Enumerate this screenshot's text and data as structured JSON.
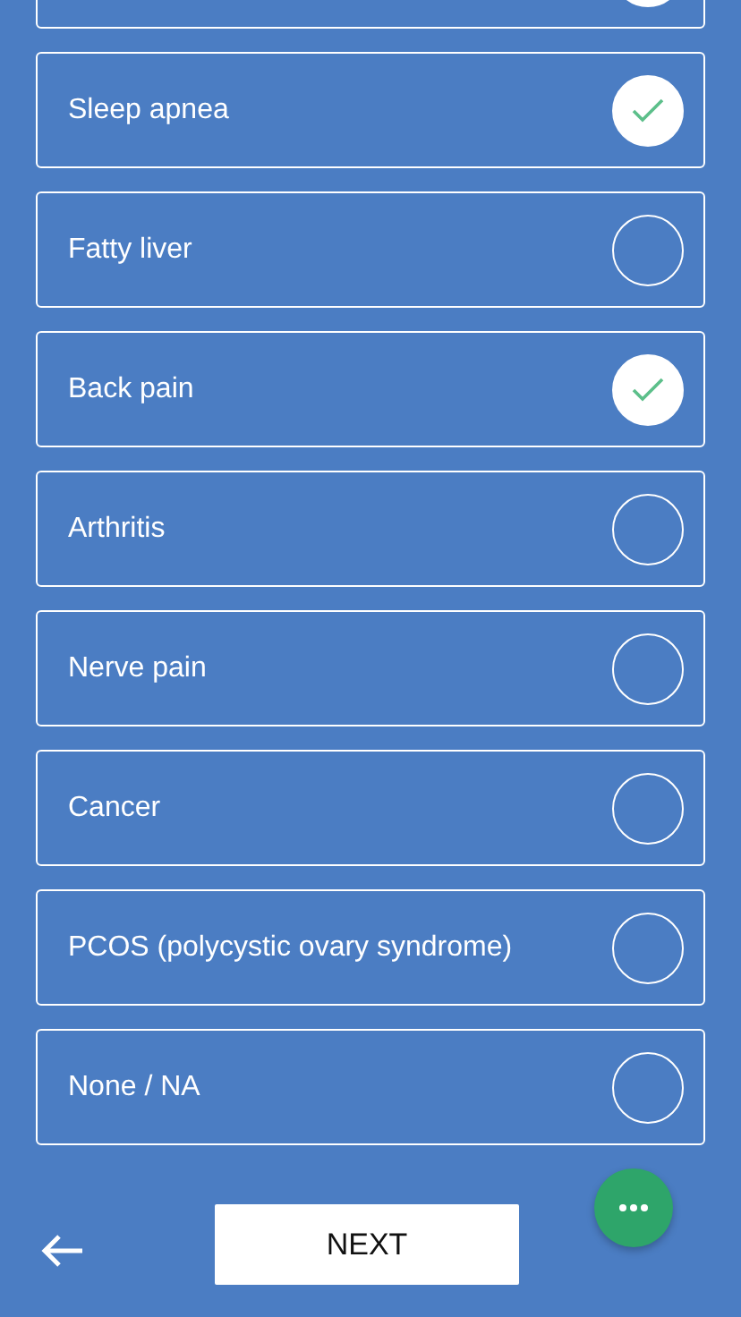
{
  "options": [
    {
      "selected": true
    },
    {
      "label": "Sleep apnea",
      "selected": true
    },
    {
      "label": "Fatty liver",
      "selected": false
    },
    {
      "label": "Back pain",
      "selected": true
    },
    {
      "label": "Arthritis",
      "selected": false
    },
    {
      "label": "Nerve pain",
      "selected": false
    },
    {
      "label": "Cancer",
      "selected": false
    },
    {
      "label": "PCOS (polycystic ovary syndrome)",
      "selected": false
    },
    {
      "label": "None / NA",
      "selected": false
    }
  ],
  "next_button": "NEXT"
}
